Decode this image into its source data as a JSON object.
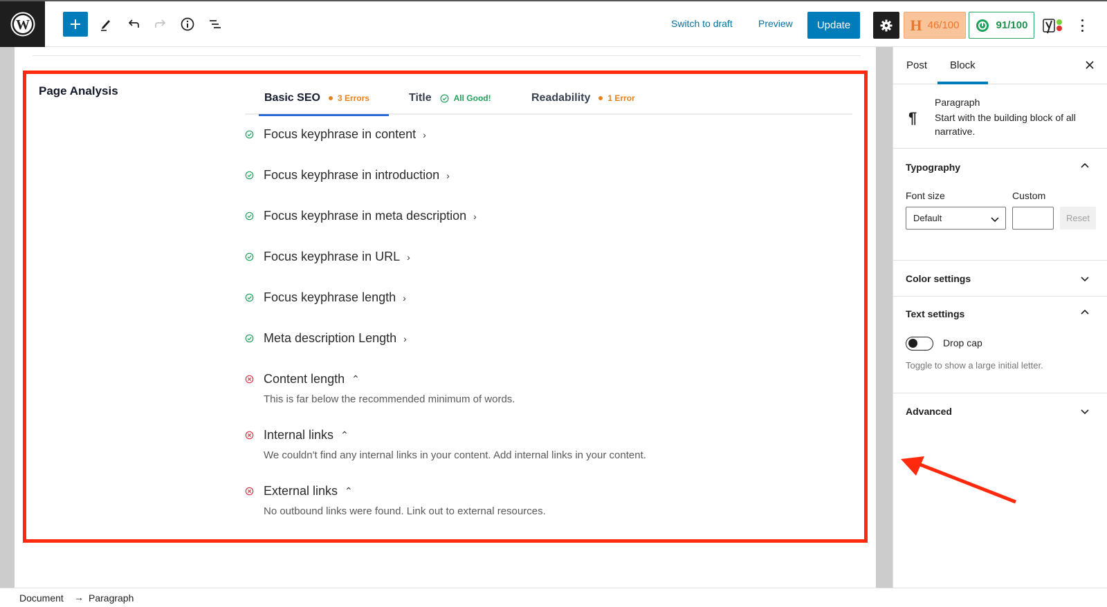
{
  "toolbar": {
    "switch_to_draft": "Switch to draft",
    "preview": "Preview",
    "update": "Update",
    "headline_score": "46/100",
    "seo_score": "91/100",
    "icons": [
      "wordpress-logo",
      "plus-icon",
      "pencil-icon",
      "undo-icon",
      "redo-icon",
      "info-icon",
      "list-view-icon",
      "gear-icon",
      "headline-h-icon",
      "seo-score-icon",
      "yoast-icon",
      "more-vertical-icon"
    ]
  },
  "page_analysis": {
    "title": "Page Analysis",
    "tabs": [
      {
        "label": "Basic SEO",
        "badge": "3 Errors",
        "status": "warn",
        "active": true
      },
      {
        "label": "Title",
        "badge": "All Good!",
        "status": "good",
        "active": false
      },
      {
        "label": "Readability",
        "badge": "1 Error",
        "status": "warn",
        "active": false
      }
    ],
    "checks": [
      {
        "label": "Focus keyphrase in content",
        "status": "pass",
        "expanded": false
      },
      {
        "label": "Focus keyphrase in introduction",
        "status": "pass",
        "expanded": false
      },
      {
        "label": "Focus keyphrase in meta description",
        "status": "pass",
        "expanded": false
      },
      {
        "label": "Focus keyphrase in URL",
        "status": "pass",
        "expanded": false
      },
      {
        "label": "Focus keyphrase length",
        "status": "pass",
        "expanded": false
      },
      {
        "label": "Meta description Length",
        "status": "pass",
        "expanded": false
      },
      {
        "label": "Content length",
        "status": "fail",
        "expanded": true,
        "description": "This is far below the recommended minimum of words."
      },
      {
        "label": "Internal links",
        "status": "fail",
        "expanded": true,
        "description": "We couldn't find any internal links in your content. Add internal links in your content."
      },
      {
        "label": "External links",
        "status": "fail",
        "expanded": true,
        "description": "No outbound links were found. Link out to external resources."
      }
    ]
  },
  "sidebar": {
    "tabs": [
      "Post",
      "Block"
    ],
    "active_tab": "Block",
    "block": {
      "name": "Paragraph",
      "description": "Start with the building block of all narrative."
    },
    "typography": {
      "title": "Typography",
      "font_size_label": "Font size",
      "custom_label": "Custom",
      "font_size_value": "Default",
      "custom_value": "",
      "reset_label": "Reset"
    },
    "color_settings": {
      "title": "Color settings"
    },
    "text_settings": {
      "title": "Text settings",
      "drop_cap_label": "Drop cap",
      "drop_cap_on": false,
      "help": "Toggle to show a large initial letter."
    },
    "advanced": {
      "title": "Advanced"
    }
  },
  "breadcrumb": [
    "Document",
    "Paragraph"
  ],
  "colors": {
    "wp_blue": "#007cba",
    "annotation_red": "#ff2a0d",
    "pass_green": "#1ea15b",
    "fail_red": "#d63649",
    "warn_orange": "#e8821f"
  }
}
